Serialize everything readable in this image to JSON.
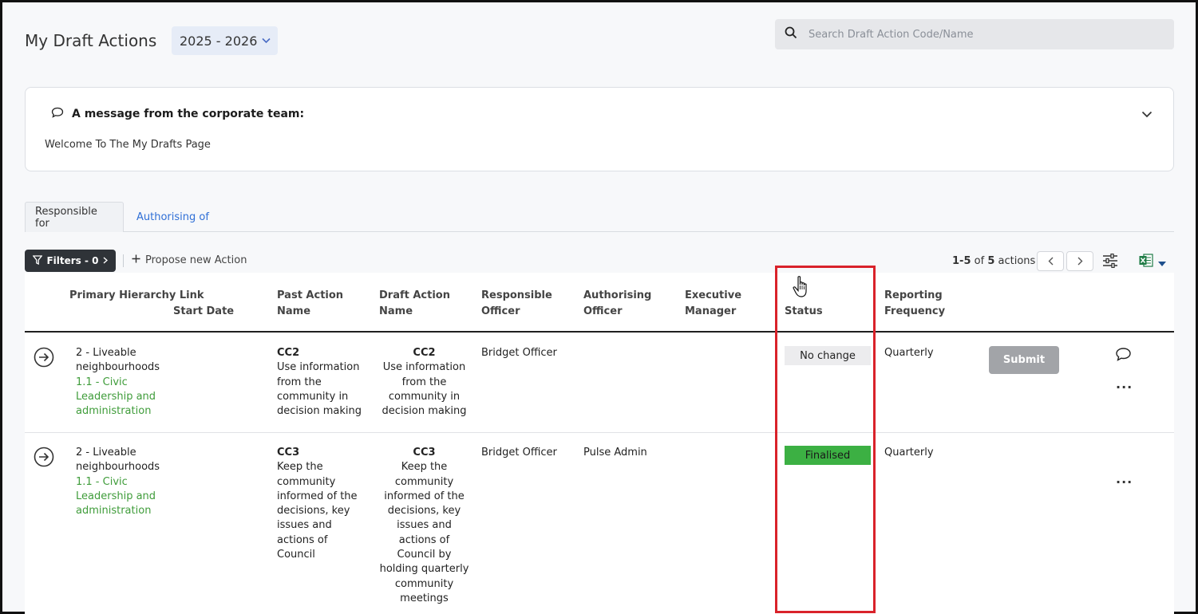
{
  "header": {
    "title": "My Draft Actions",
    "year": "2025 - 2026",
    "search_placeholder": "Search Draft Action Code/Name"
  },
  "message": {
    "title": "A message from the corporate team:",
    "body": "Welcome To The My Drafts Page"
  },
  "tabs": [
    {
      "label": "Responsible for",
      "active": true
    },
    {
      "label": "Authorising of",
      "active": false
    }
  ],
  "toolbar": {
    "filters_label": "Filters - 0",
    "propose_label": "Propose new Action",
    "range": "1-5",
    "of": "of",
    "total": "5",
    "unit": "actions"
  },
  "table": {
    "columns": [
      "Primary Hierarchy Link",
      "Start Date",
      "Past Action Name",
      "Draft Action Name",
      "Responsible Officer",
      "Authorising Officer",
      "Executive Manager",
      "Status",
      "Reporting Frequency"
    ],
    "rows": [
      {
        "hierarchy": "2 - Liveable neighbourhoods",
        "sub_hierarchy": "1.1 - Civic Leadership and administration",
        "start_date": "",
        "past_code": "CC2",
        "past_name": "Use information from the community in decision making",
        "draft_code": "CC2",
        "draft_name": "Use information from the community in decision making",
        "responsible": "Bridget Officer",
        "authorising": "",
        "executive": "",
        "status": "No change",
        "frequency": "Quarterly",
        "submit_label": "Submit",
        "more_label": "..."
      },
      {
        "hierarchy": "2 - Liveable neighbourhoods",
        "sub_hierarchy": "1.1 - Civic Leadership and administration",
        "start_date": "",
        "past_code": "CC3",
        "past_name": "Keep the community informed of the decisions, key issues and actions of Council",
        "draft_code": "CC3",
        "draft_name": "Keep the community informed of the decisions, key issues and actions of Council by holding quarterly community meetings",
        "responsible": "Bridget Officer",
        "authorising": "Pulse Admin",
        "executive": "",
        "status": "Finalised",
        "frequency": "Quarterly",
        "more_label": "..."
      }
    ]
  },
  "colors": {
    "status_finalised": "#3cb043",
    "status_nochange": "#ececee",
    "link_blue": "#2f6fd6",
    "hierarchy_green": "#3f9c3a",
    "highlight": "#d9222a"
  }
}
